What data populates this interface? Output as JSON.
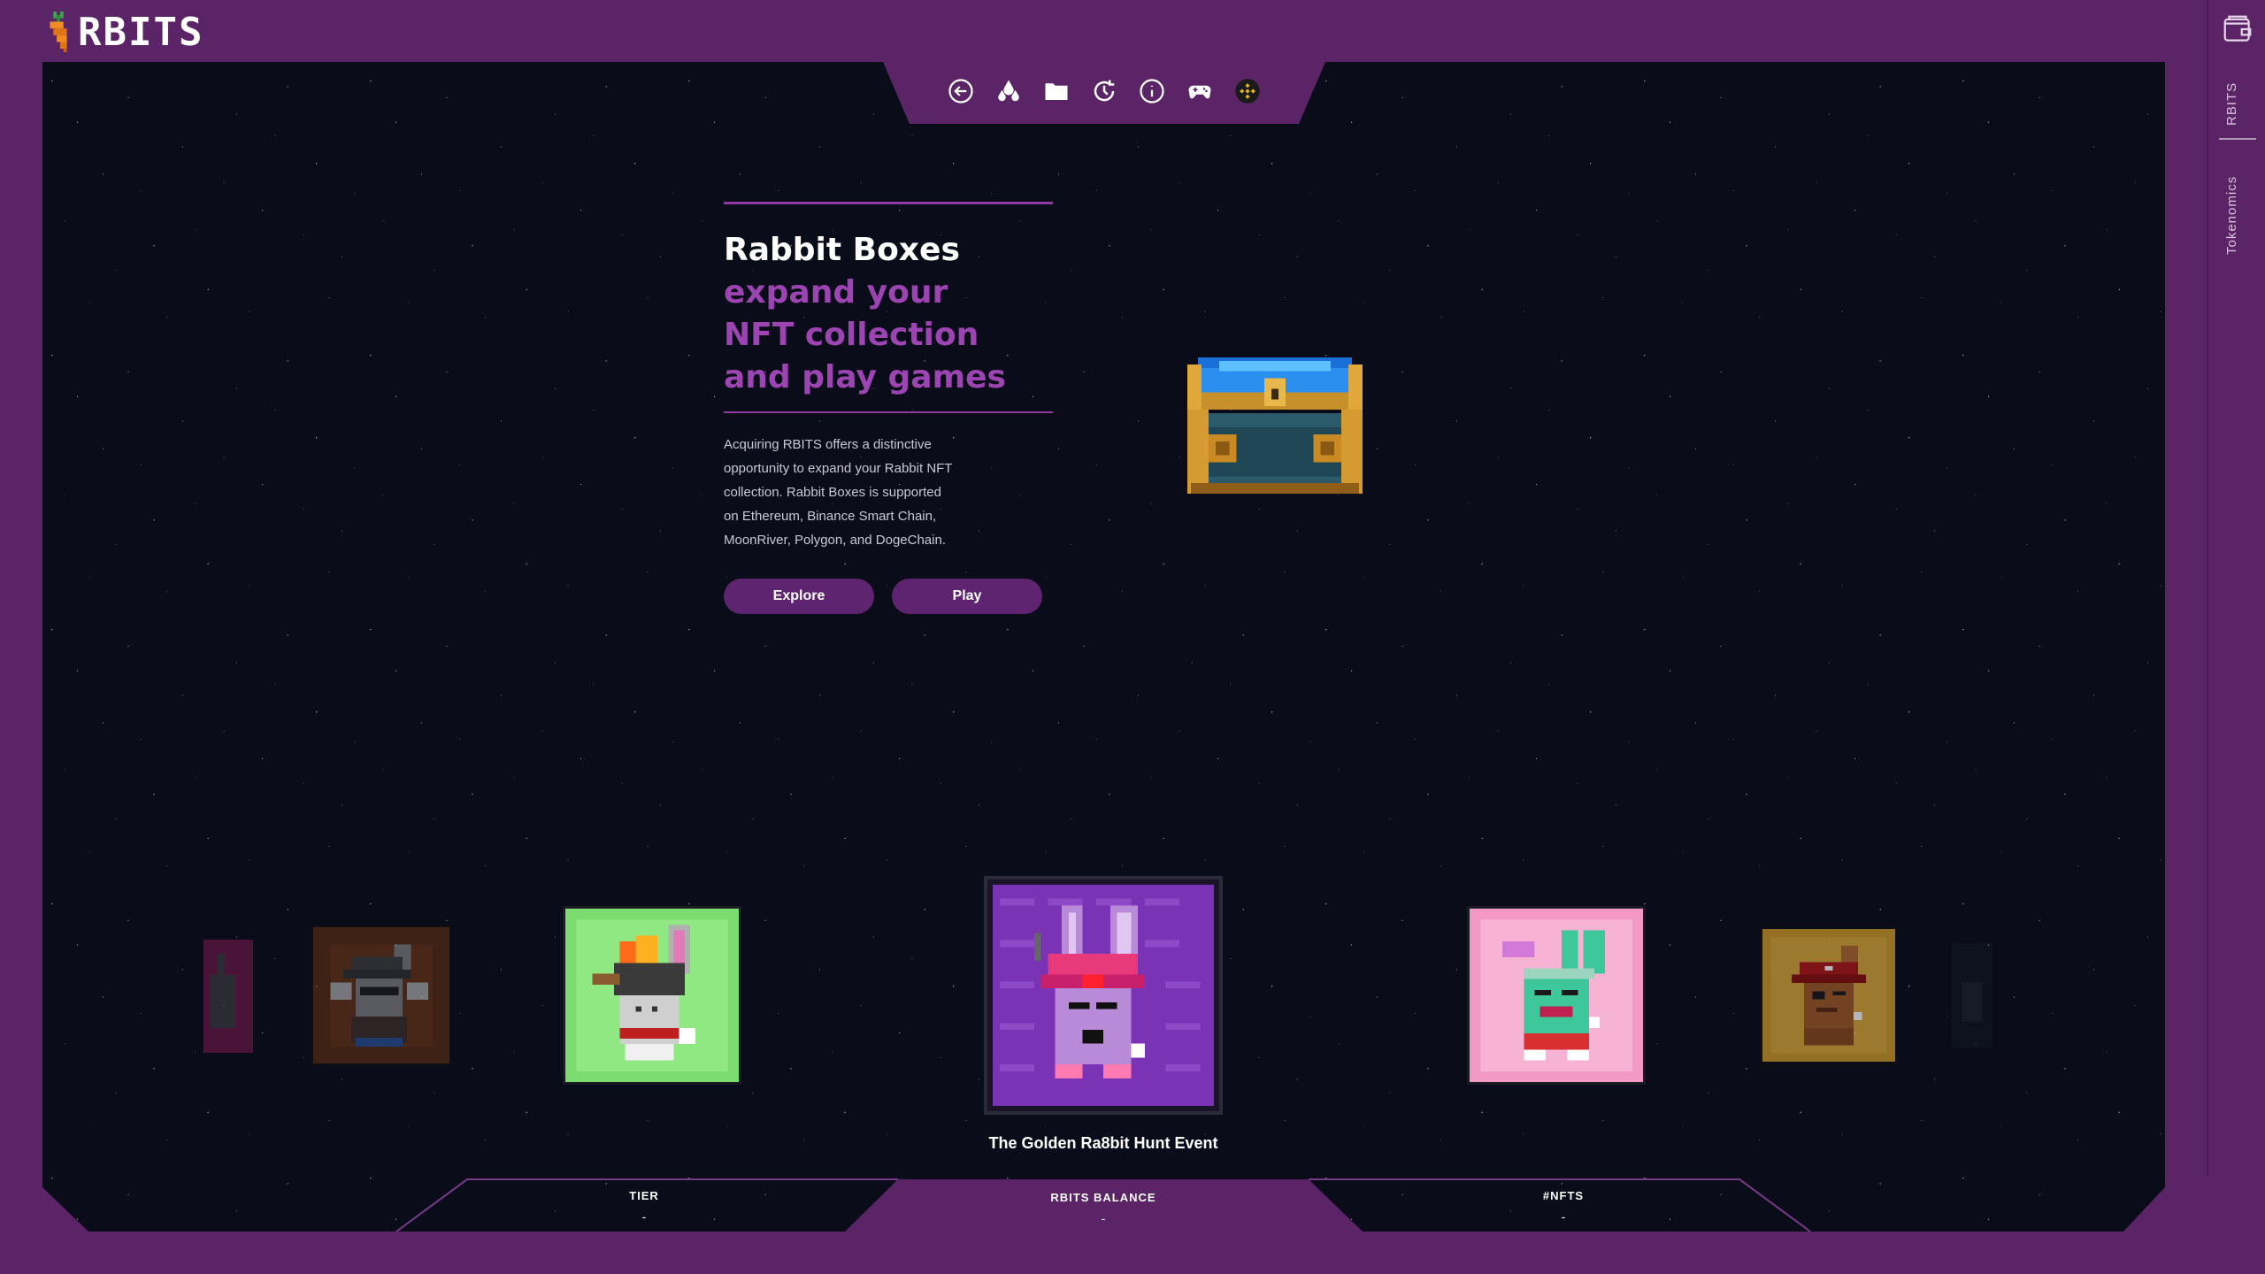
{
  "logo": {
    "text": "RBITS",
    "icon": "carrot-icon"
  },
  "top_nav": {
    "icons": [
      "back-arrow-icon",
      "drops-icon",
      "folder-icon",
      "refresh-clock-icon",
      "info-icon",
      "gamepad-icon",
      "binance-icon"
    ]
  },
  "side_panel": {
    "wallet_icon": "wallet-icon",
    "tabs": [
      {
        "label": "RBITS"
      },
      {
        "label": "Tokenomics"
      }
    ]
  },
  "hero": {
    "title": "Rabbit Boxes",
    "subtitle": "expand your NFT collection and play games",
    "description": "Acquiring RBITS offers a distinctive opportunity to expand your Rabbit NFT collection. Rabbit Boxes is supported on Ethereum, Binance Smart Chain, MoonRiver, Polygon, and DogeChain.",
    "buttons": {
      "explore": "Explore",
      "play": "Play"
    }
  },
  "carousel": {
    "caption": "The Golden Ra8bit Hunt Event",
    "cards": [
      {
        "name": "pink-rabbit",
        "bg": "#b0256e"
      },
      {
        "name": "witch-rabbit",
        "bg": "#6a3414"
      },
      {
        "name": "robot-helmet-rabbit",
        "bg": "#7ddc70"
      },
      {
        "name": "pink-helmet-rabbit",
        "bg": "#7a33b5"
      },
      {
        "name": "green-hipster-rabbit",
        "bg": "#f29ac4"
      },
      {
        "name": "pirate-rabbit",
        "bg": "#cf9b2a"
      },
      {
        "name": "dark-rabbit",
        "bg": "#22303a"
      }
    ]
  },
  "stats": {
    "tier": {
      "label": "TIER",
      "value": "-"
    },
    "balance": {
      "label": "RBITS BALANCE",
      "value": "-"
    },
    "nfts": {
      "label": "#NFTS",
      "value": "-"
    }
  },
  "colors": {
    "frame": "#5b2466",
    "space": "#0b0c19",
    "accent": "#9b44b2",
    "button": "#5f2470"
  }
}
